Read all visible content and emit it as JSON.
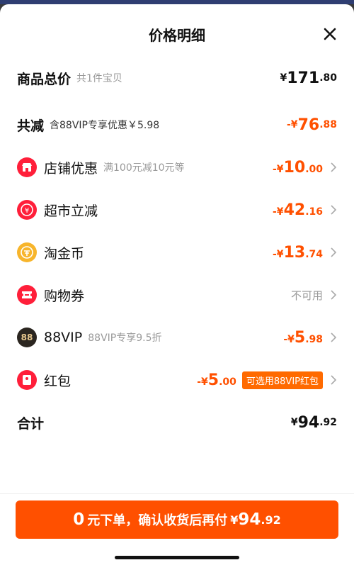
{
  "title": "价格明细",
  "rows": {
    "total": {
      "label": "商品总价",
      "sub": "共1件宝贝",
      "yen": "¥",
      "int": "171",
      "dec": ".80"
    },
    "reduce": {
      "label": "共减",
      "sub": "含88VIP专享优惠￥5.98",
      "yen": "-¥",
      "int": "76",
      "dec": ".88"
    },
    "shop": {
      "label": "店铺优惠",
      "sub": "满100元减10元等",
      "yen": "-¥",
      "int": "10",
      "dec": ".00"
    },
    "market": {
      "label": "超市立减",
      "yen": "-¥",
      "int": "42",
      "dec": ".16"
    },
    "coins": {
      "label": "淘金币",
      "yen": "-¥",
      "int": "13",
      "dec": ".74"
    },
    "coupon": {
      "label": "购物券",
      "status": "不可用"
    },
    "vip": {
      "label": "88VIP",
      "sub": "88VIP专享9.5折",
      "icon_text": "88",
      "yen": "-¥",
      "int": "5",
      "dec": ".98"
    },
    "redpacket": {
      "label": "红包",
      "yen": "-¥",
      "int": "5",
      "dec": ".00",
      "badge": "可选用88VIP红包"
    },
    "sum": {
      "label": "合计",
      "yen": "¥",
      "int": "94",
      "dec": ".92"
    }
  },
  "cta": {
    "n": "0",
    "t": "元下单，确认收货后再付",
    "yen": "¥",
    "int": "94",
    "dec": ".92"
  },
  "colors": {
    "accent": "#ff5000",
    "text": "#111111",
    "muted": "#999999"
  }
}
